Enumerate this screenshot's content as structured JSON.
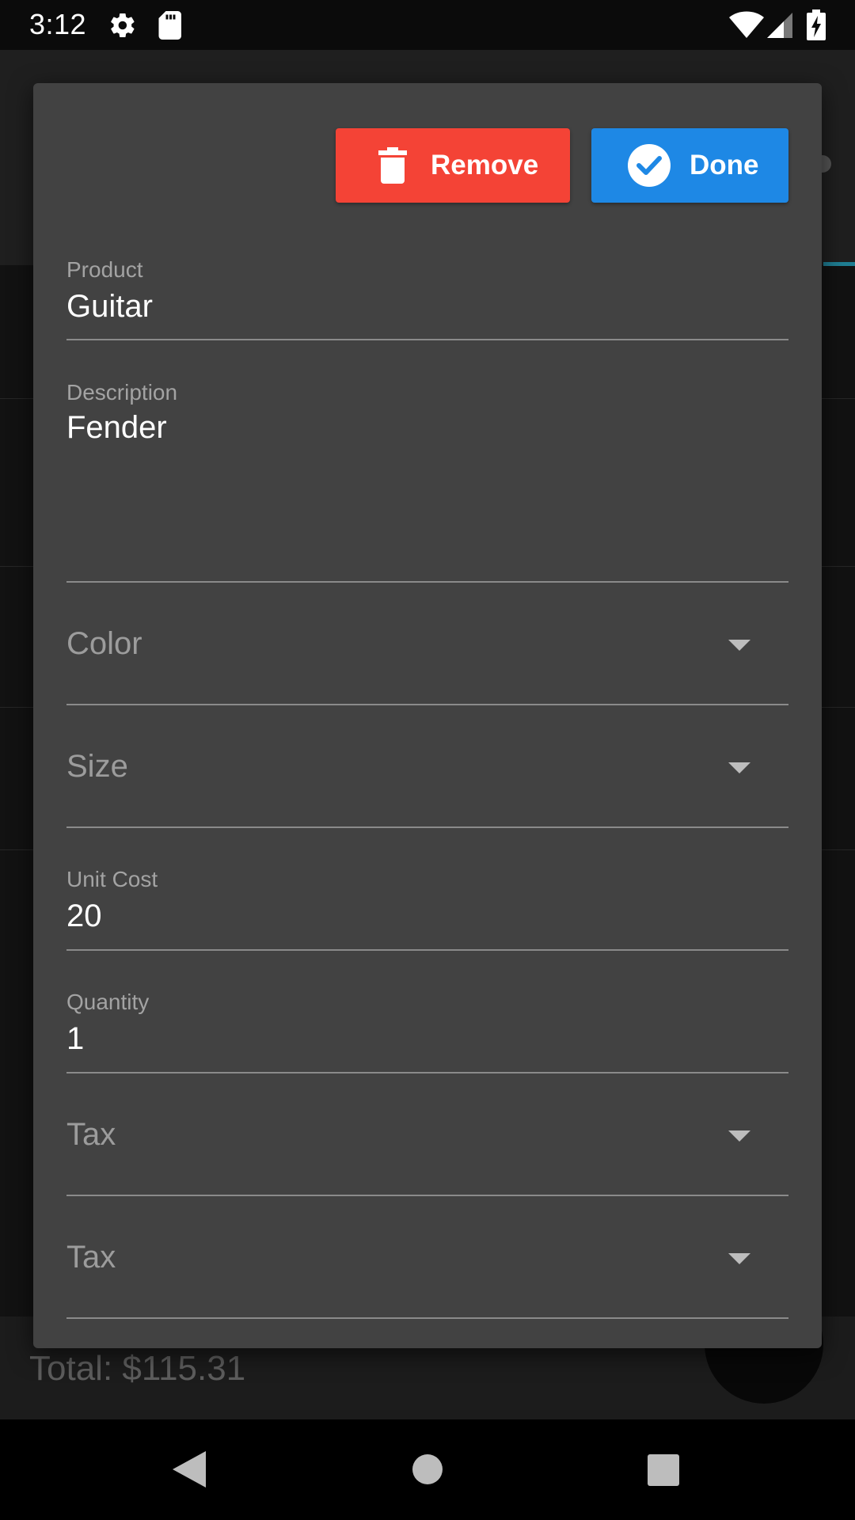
{
  "status_bar": {
    "time": "3:12",
    "icons": [
      "gear-icon",
      "sd-card-icon",
      "wifi-icon",
      "cell-signal-icon",
      "battery-charging-icon"
    ]
  },
  "background": {
    "total_text": "Total: $115.31"
  },
  "dialog": {
    "remove_label": "Remove",
    "done_label": "Done",
    "remove_icon": "trash-icon",
    "done_icon": "check-circle-icon",
    "colors": {
      "remove": "#f44336",
      "done": "#1e88e5",
      "surface": "#424242"
    },
    "fields": {
      "product": {
        "label": "Product",
        "value": "Guitar"
      },
      "description": {
        "label": "Description",
        "value": "Fender"
      },
      "color": {
        "placeholder": "Color"
      },
      "size": {
        "placeholder": "Size"
      },
      "unit_cost": {
        "label": "Unit Cost",
        "value": "20"
      },
      "quantity": {
        "label": "Quantity",
        "value": "1"
      },
      "tax1": {
        "placeholder": "Tax"
      },
      "tax2": {
        "placeholder": "Tax"
      }
    }
  },
  "nav_bar": {
    "icons": [
      "back-icon",
      "home-icon",
      "recents-icon"
    ]
  }
}
